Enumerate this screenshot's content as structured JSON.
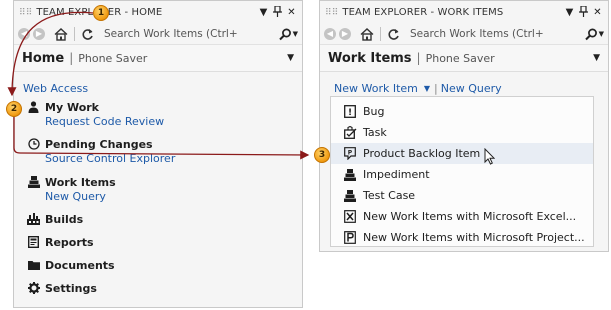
{
  "left_panel": {
    "title": "TEAM EXPLORER - HOME",
    "search": {
      "placeholder": "Search Work Items (Ctrl+"
    },
    "header": {
      "page_title": "Home",
      "separator": "|",
      "project": "Phone Saver"
    },
    "web_access": "Web Access",
    "sections": [
      {
        "label": "My Work",
        "link": "Request Code Review",
        "icon": "person-icon"
      },
      {
        "label": "Pending Changes",
        "link": "Source Control Explorer",
        "icon": "clock-icon"
      },
      {
        "label": "Work Items",
        "link": "New Query",
        "icon": "work-items-icon"
      },
      {
        "label": "Builds",
        "icon": "builds-icon"
      },
      {
        "label": "Reports",
        "icon": "reports-icon"
      },
      {
        "label": "Documents",
        "icon": "folder-icon"
      },
      {
        "label": "Settings",
        "icon": "gear-icon"
      }
    ]
  },
  "right_panel": {
    "title": "TEAM EXPLORER - WORK ITEMS",
    "search": {
      "placeholder": "Search Work Items (Ctrl+"
    },
    "header": {
      "page_title": "Work Items",
      "separator": "|",
      "project": "Phone Saver"
    },
    "new_work_item": "New Work Item",
    "pipe": "|",
    "new_query": "New Query",
    "menu_items": [
      {
        "label": "Bug",
        "icon": "bug-icon"
      },
      {
        "label": "Task",
        "icon": "task-icon"
      },
      {
        "label": "Product Backlog Item",
        "icon": "backlog-item-icon",
        "highlighted": true
      },
      {
        "label": "Impediment",
        "icon": "impediment-icon"
      },
      {
        "label": "Test Case",
        "icon": "test-case-icon"
      },
      {
        "label": "New Work Items with Microsoft Excel...",
        "icon": "excel-icon"
      },
      {
        "label": "New Work Items with Microsoft Project...",
        "icon": "project-icon"
      }
    ]
  },
  "callouts": [
    "1",
    "2",
    "3"
  ],
  "colors": {
    "link": "#1e5aa8",
    "arrow": "#8b1a1a",
    "callout": "#f5a623",
    "highlight": "#e8edf4"
  }
}
